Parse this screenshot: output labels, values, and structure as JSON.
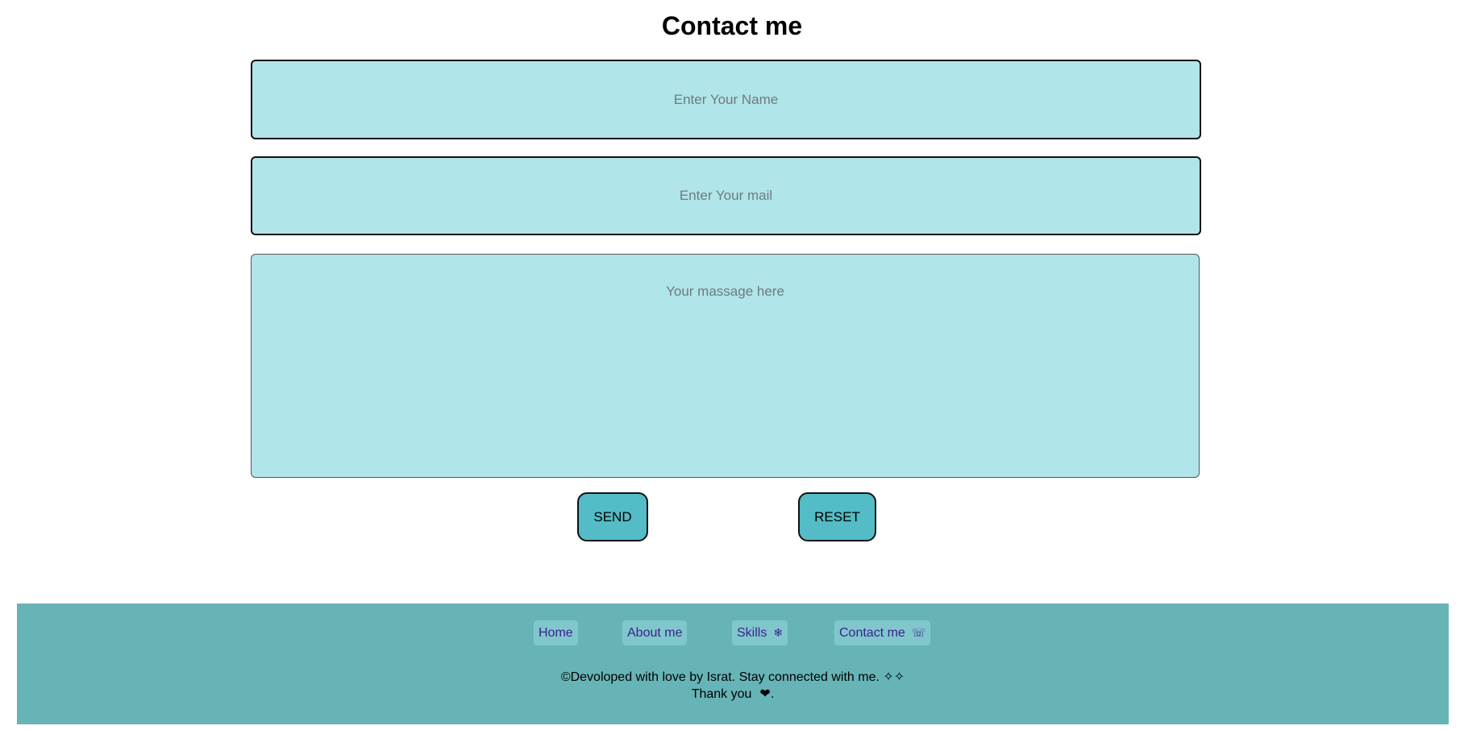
{
  "form": {
    "title": "Contact me",
    "name_placeholder": "Enter Your Name",
    "mail_placeholder": "Enter Your mail",
    "message_placeholder": "Your massage here",
    "send_label": "SEND",
    "reset_label": "RESET"
  },
  "footer": {
    "nav": {
      "home": "Home",
      "about": "About me",
      "skills": "Skills",
      "skills_glyph": "❄",
      "contact": "Contact me",
      "contact_glyph": "☏"
    },
    "line1": "©Devoloped with love by Israt. Stay connected with me. ✧✧",
    "line2": "Thank you",
    "heart": "❤",
    "line2_end": "."
  },
  "colors": {
    "field_bg": "#b0e5e9",
    "button_bg": "#53bcc6",
    "footer_bg": "#67b4b7",
    "link_color": "#3d1f8f"
  }
}
